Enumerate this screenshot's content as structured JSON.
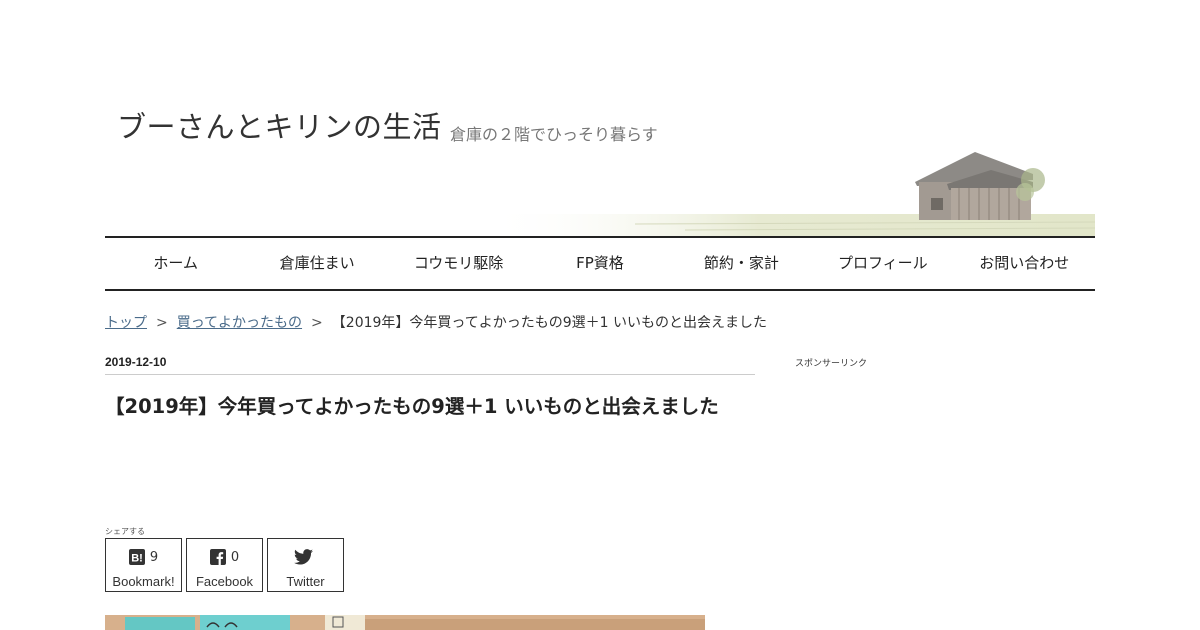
{
  "header": {
    "site_title": "ブーさんとキリンの生活",
    "site_description": "倉庫の２階でひっそり暮らす"
  },
  "nav": {
    "items": [
      {
        "label": "ホーム"
      },
      {
        "label": "倉庫住まい"
      },
      {
        "label": "コウモリ駆除"
      },
      {
        "label": "FP資格"
      },
      {
        "label": "節約・家計"
      },
      {
        "label": "プロフィール"
      },
      {
        "label": "お問い合わせ"
      }
    ]
  },
  "breadcrumb": {
    "top": "トップ",
    "category": "買ってよかったもの",
    "current": "【2019年】今年買ってよかったもの9選＋1 いいものと出会えました",
    "separator": ">"
  },
  "article": {
    "date": "2019-12-10",
    "title": "【2019年】今年買ってよかったもの9選＋1 いいものと出会えました"
  },
  "sidebar": {
    "sponsor_label": "スポンサーリンク"
  },
  "share": {
    "label": "シェアする",
    "buttons": [
      {
        "icon": "hatena-bookmark-icon",
        "count": "9",
        "name": "Bookmark!"
      },
      {
        "icon": "facebook-icon",
        "count": "0",
        "name": "Facebook"
      },
      {
        "icon": "twitter-icon",
        "count": "",
        "name": "Twitter"
      }
    ]
  },
  "colors": {
    "nav_border": "#222222",
    "link": "#4a6b8a",
    "eyecatch": "#d7b08c"
  }
}
